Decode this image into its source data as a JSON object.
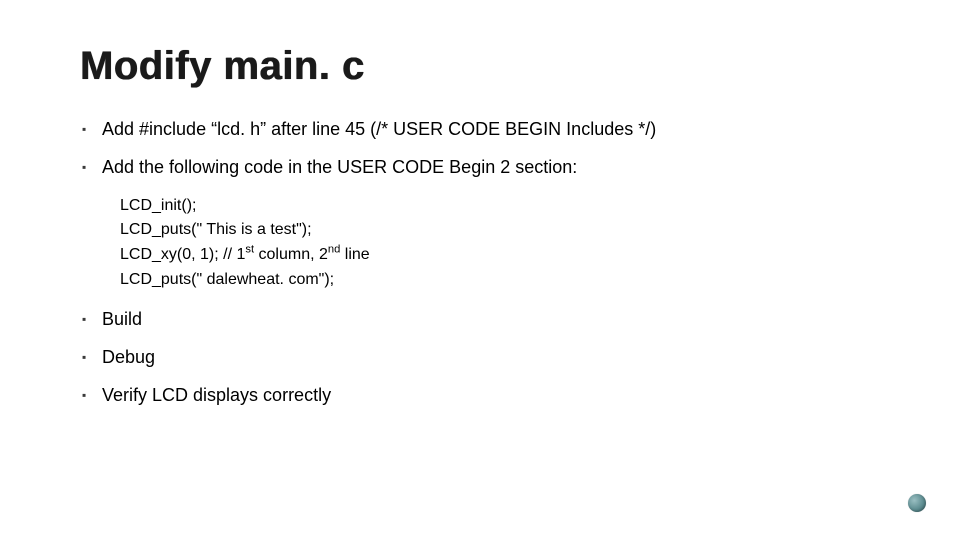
{
  "title": "Modify main. c",
  "bullets": [
    "Add #include “lcd. h” after line 45 (/* USER CODE BEGIN Includes */)",
    "Add the following code in the USER CODE Begin 2 section:",
    "Build",
    "Debug",
    "Verify LCD displays correctly"
  ],
  "code": {
    "line1": "LCD_init();",
    "line2": "LCD_puts(\" This is a test\");",
    "line3_pre": "LCD_xy(0, 1); // 1",
    "line3_sup1": "st",
    "line3_mid": " column, 2",
    "line3_sup2": "nd",
    "line3_post": " line",
    "line4": "LCD_puts(\" dalewheat. com\");"
  }
}
